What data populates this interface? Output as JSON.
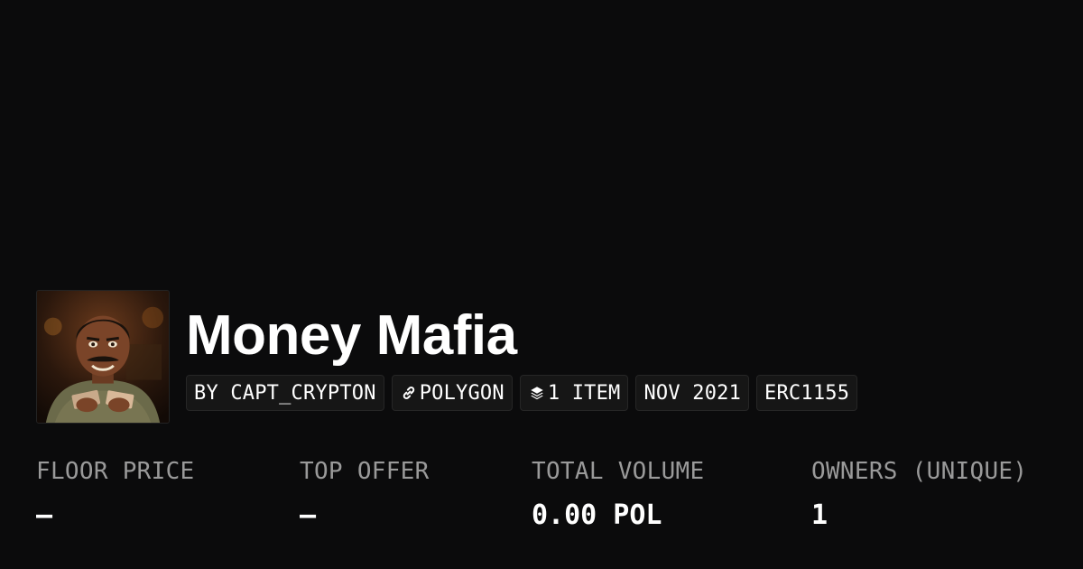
{
  "collection": {
    "name": "Money Mafia",
    "avatar_alt": "collection-avatar"
  },
  "tags": {
    "creator": "BY CAPT_CRYPTON",
    "chain": "POLYGON",
    "chain_icon": "link-icon",
    "items": "1 ITEM",
    "items_icon": "layers-icon",
    "date": "NOV 2021",
    "standard": "ERC1155"
  },
  "stats": {
    "floor_price": {
      "label": "FLOOR PRICE",
      "value": "–"
    },
    "top_offer": {
      "label": "TOP OFFER",
      "value": "–"
    },
    "total_volume": {
      "label": "TOTAL VOLUME",
      "value": "0.00 POL"
    },
    "owners": {
      "label": "OWNERS (UNIQUE)",
      "value": "1"
    }
  },
  "colors": {
    "background": "#0b0b0c",
    "text_primary": "#ffffff",
    "text_muted": "#9a9a9a",
    "tag_background": "#161616",
    "tag_border": "#262626"
  }
}
